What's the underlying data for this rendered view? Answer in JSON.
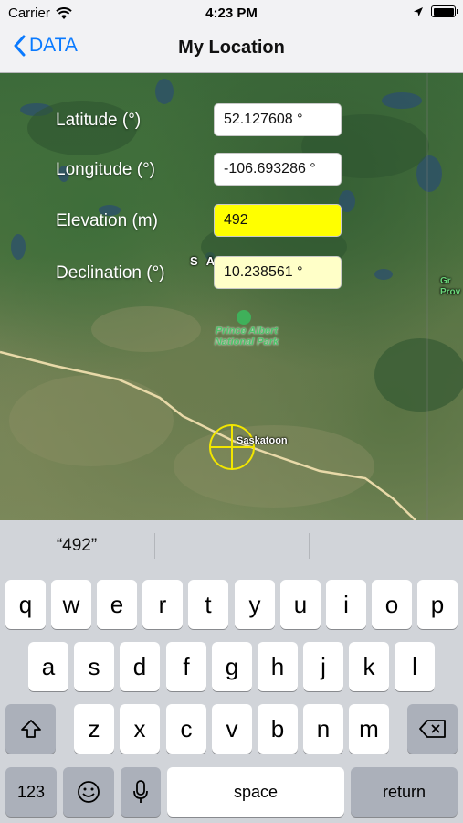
{
  "status_bar": {
    "carrier": "Carrier",
    "time": "4:23 PM"
  },
  "nav": {
    "back_label": "DATA",
    "title": "My Location"
  },
  "fields": [
    {
      "label": "Latitude (°)",
      "value": "52.127608 °",
      "color": "#ffffff"
    },
    {
      "label": "Longitude (°)",
      "value": "-106.693286 °",
      "color": "#ffffff"
    },
    {
      "label": "Elevation (m)",
      "value": "492",
      "color": "#ffff00"
    },
    {
      "label": "Declination (°)",
      "value": "10.238561 °",
      "color": "#ffffc8"
    }
  ],
  "map": {
    "province_label": "S A",
    "park_label": "Prince Albert National Park",
    "city_label": "Saskatoon",
    "edge_label": "Gr Prov"
  },
  "keyboard": {
    "suggestions": [
      "“492”",
      "",
      ""
    ],
    "row1": [
      "q",
      "w",
      "e",
      "r",
      "t",
      "y",
      "u",
      "i",
      "o",
      "p"
    ],
    "row2": [
      "a",
      "s",
      "d",
      "f",
      "g",
      "h",
      "j",
      "k",
      "l"
    ],
    "row3": [
      "z",
      "x",
      "c",
      "v",
      "b",
      "n",
      "m"
    ],
    "numbers_label": "123",
    "space_label": "space",
    "return_label": "return"
  },
  "colors": {
    "accent": "#0a7aff",
    "marker": "#f2e600"
  }
}
